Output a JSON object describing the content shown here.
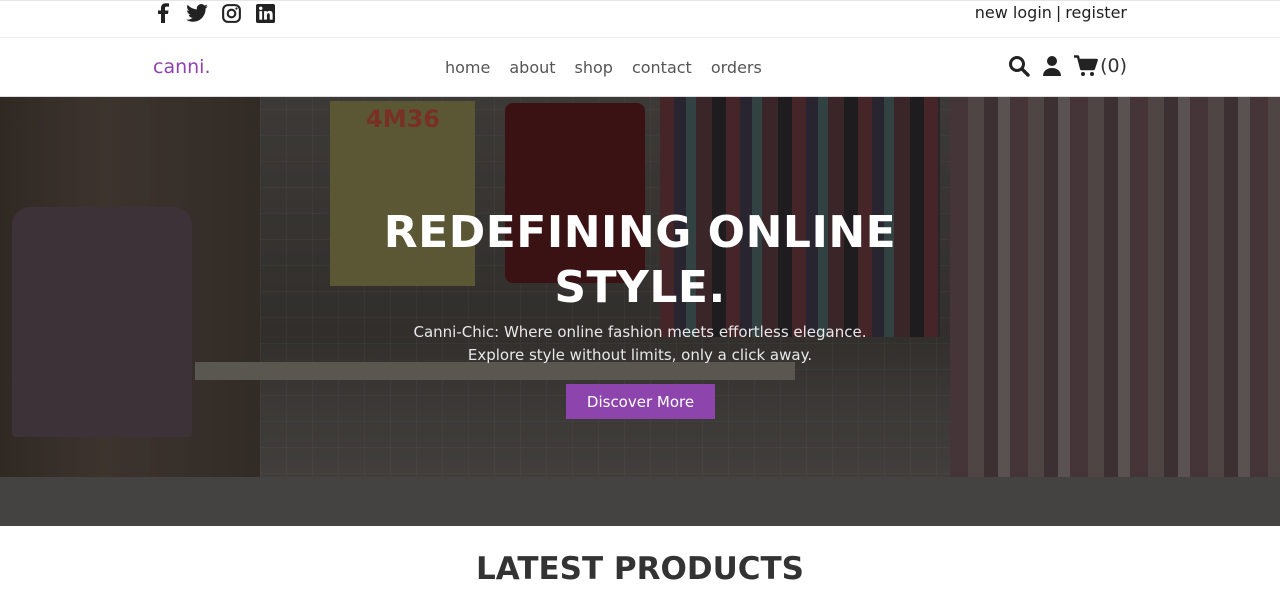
{
  "social": {
    "icons": [
      "facebook-icon",
      "twitter-icon",
      "instagram-icon",
      "linkedin-icon"
    ]
  },
  "auth": {
    "login_label": "new login",
    "separator": "|",
    "register_label": "register"
  },
  "brand": {
    "name": "canni."
  },
  "nav": {
    "links": [
      "home",
      "about",
      "shop",
      "contact",
      "orders"
    ]
  },
  "nav_icons": {
    "search": "search-icon",
    "user": "user-icon",
    "cart": "cart-icon",
    "cart_count": "(0)"
  },
  "hero": {
    "poster_text": "4M36",
    "title": "REDEFINING ONLINE STYLE.",
    "subtitle": "Canni-Chic: Where online fashion meets effortless elegance. Explore style without limits, only a click away.",
    "button_label": "Discover More"
  },
  "latest": {
    "title": "LATEST PRODUCTS"
  },
  "colors": {
    "brand": "#8e44ad",
    "text": "#333333"
  }
}
